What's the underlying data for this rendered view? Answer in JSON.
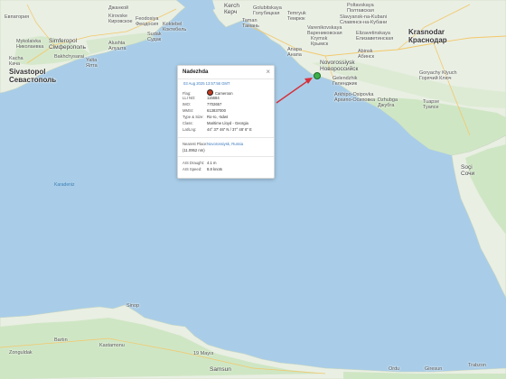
{
  "map": {
    "places": [
      {
        "id": "dzhankoi",
        "text": "Джанкой"
      },
      {
        "id": "evpatoria",
        "text": "Евпатория"
      },
      {
        "id": "mykolaivka",
        "text": "Mykolaivka"
      },
      {
        "id": "mykolaivka_ru",
        "text": "Николаевка"
      },
      {
        "id": "simferopol",
        "text": "Simferopol"
      },
      {
        "id": "simferopol_ru",
        "text": "Сімферополь"
      },
      {
        "id": "kacha",
        "text": "Kacha"
      },
      {
        "id": "kacha_ru",
        "text": "Кача"
      },
      {
        "id": "sevastopol",
        "text": "Sivastopol"
      },
      {
        "id": "sevastopol_ru",
        "text": "Севастополь"
      },
      {
        "id": "bakhchysarai",
        "text": "Bakhchysarai"
      },
      {
        "id": "alushta",
        "text": "Alushta"
      },
      {
        "id": "alushta_ru",
        "text": "Алушта"
      },
      {
        "id": "sudak",
        "text": "Sudak"
      },
      {
        "id": "sudak_ru",
        "text": "Судак"
      },
      {
        "id": "yalta",
        "text": "Yalta"
      },
      {
        "id": "yalta_ru",
        "text": "Ялта"
      },
      {
        "id": "koktebel",
        "text": "Koktebel"
      },
      {
        "id": "koktebel_ru",
        "text": "Коктебель"
      },
      {
        "id": "feodosiya",
        "text": "Feodosiya"
      },
      {
        "id": "feodosiya_ru",
        "text": "Феодосия"
      },
      {
        "id": "kirovske",
        "text": "Kirovske"
      },
      {
        "id": "kirovske_ru",
        "text": "Кировское"
      },
      {
        "id": "kerch",
        "text": "Kerch"
      },
      {
        "id": "kerch_ru",
        "text": "Керч"
      },
      {
        "id": "taman",
        "text": "Taman"
      },
      {
        "id": "taman_ru",
        "text": "Тамань"
      },
      {
        "id": "golubitskaya",
        "text": "Golubitskaya"
      },
      {
        "id": "golubitskaya_ru",
        "text": "Голубицкая"
      },
      {
        "id": "temryuk",
        "text": "Temryuk"
      },
      {
        "id": "temryuk_ru",
        "text": "Темрюк"
      },
      {
        "id": "poltavskaya",
        "text": "Poltavskaya"
      },
      {
        "id": "poltavskaya_ru",
        "text": "Полтавская"
      },
      {
        "id": "slavyansk",
        "text": "Slavyansk-na-Kubani"
      },
      {
        "id": "slavyansk_ru",
        "text": "Славянск-на-Кубани"
      },
      {
        "id": "krymsk",
        "text": "Krymsk"
      },
      {
        "id": "krymsk_ru",
        "text": "Крымск"
      },
      {
        "id": "varenikovskaya",
        "text": "Varenikovskaya"
      },
      {
        "id": "varenikovskaya_ru",
        "text": "Варениковская"
      },
      {
        "id": "elizavetinskaya",
        "text": "Elizavetinskaya"
      },
      {
        "id": "elizavetinskaya_ru",
        "text": "Елизаветинская"
      },
      {
        "id": "abinsk",
        "text": "Abinsk"
      },
      {
        "id": "abinsk_ru",
        "text": "Абинск"
      },
      {
        "id": "krasnodar",
        "text": "Krasnodar"
      },
      {
        "id": "krasnodar_ru",
        "text": "Краснодар"
      },
      {
        "id": "anapa",
        "text": "Anapa"
      },
      {
        "id": "anapa_ru",
        "text": "Анапа"
      },
      {
        "id": "novorossiysk",
        "text": "Novorossiysk"
      },
      {
        "id": "novorossiysk_ru",
        "text": "Новороссийск"
      },
      {
        "id": "gelendzhik",
        "text": "Gelendzhik"
      },
      {
        "id": "gelendzhik_ru",
        "text": "Геленджик"
      },
      {
        "id": "arkhipo",
        "text": "Arkhipo-Osipovka"
      },
      {
        "id": "arkhipo_ru",
        "text": "Архипо-Осиповка"
      },
      {
        "id": "dzhubga",
        "text": "Dzhubga"
      },
      {
        "id": "dzhubga_ru",
        "text": "Джубга"
      },
      {
        "id": "tuapse",
        "text": "Tuapse"
      },
      {
        "id": "tuapse_ru",
        "text": "Туапсе"
      },
      {
        "id": "goryachy",
        "text": "Goryachy Klyuch"
      },
      {
        "id": "goryachy_ru",
        "text": "Горячий Ключ"
      },
      {
        "id": "sochi",
        "text": "Soçi"
      },
      {
        "id": "sochi_ru",
        "text": "Сочи"
      },
      {
        "id": "karadeniz",
        "text": "Karadeniz"
      },
      {
        "id": "samsun",
        "text": "Samsun"
      },
      {
        "id": "zonguldak",
        "text": "Zonguldak"
      },
      {
        "id": "sinop",
        "text": "Sinop"
      },
      {
        "id": "ordu",
        "text": "Ordu"
      },
      {
        "id": "giresun",
        "text": "Giresun"
      },
      {
        "id": "trabzon",
        "text": "Trabzon"
      },
      {
        "id": "bartin",
        "text": "Bartın"
      },
      {
        "id": "kastamonu",
        "text": "Kastamonu"
      },
      {
        "id": "19mayis",
        "text": "19 Mayıs"
      }
    ]
  },
  "popup": {
    "title": "Nadezhda",
    "close": "×",
    "date": "03 Aug 2025 13:57:56 GMT",
    "rows": [
      {
        "k": "Flag:",
        "v": "Cameroon"
      },
      {
        "k": "LLI NO:",
        "v": "115684"
      },
      {
        "k": "IMO:",
        "v": "7702657"
      },
      {
        "k": "MMSI:",
        "v": "613837000"
      },
      {
        "k": "Type & Size:",
        "v": "Ro-ro, -5dwt"
      },
      {
        "k": "Class:",
        "v": "Maritime Lloyd - Georgia"
      },
      {
        "k": "Lat/Lng:",
        "v": "44° 37' 46\" N / 37° 48' 6\" E"
      }
    ],
    "nearest_label": "Nearest Place:",
    "nearest_value": "Novorossiysk, Russia",
    "nearest_distance": "(11.0952 nm)",
    "draught_label": "AIS Draught:",
    "draught_value": "4.1 m",
    "speed_label": "AIS Speed:",
    "speed_value": "8.8 knots"
  },
  "colors": {
    "sea": "#a9cde8",
    "land": "#e9efe3",
    "land_green": "#cfe6c4",
    "arrow": "#d6303b",
    "vessel_marker": "#3fae49",
    "link": "#3b7bbf"
  }
}
